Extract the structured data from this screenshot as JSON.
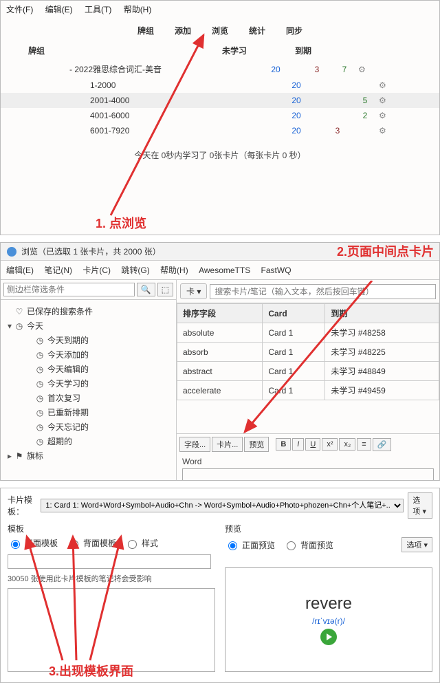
{
  "menu": {
    "file": "文件(F)",
    "edit": "编辑(E)",
    "tools": "工具(T)",
    "help": "帮助(H)"
  },
  "nav": {
    "decks": "牌组",
    "add": "添加",
    "browse": "浏览",
    "stats": "统计",
    "sync": "同步"
  },
  "deckheader": {
    "deck": "牌组",
    "new": "未学习",
    "due": "到期"
  },
  "decks": [
    {
      "name": "- 2022雅思综合词汇-美音",
      "new": "20",
      "lrn": "3",
      "due": "7",
      "root": true
    },
    {
      "name": "1-2000",
      "new": "20",
      "lrn": "",
      "due": ""
    },
    {
      "name": "2001-4000",
      "new": "20",
      "lrn": "",
      "due": "5",
      "alt": true
    },
    {
      "name": "4001-6000",
      "new": "20",
      "lrn": "",
      "due": "2"
    },
    {
      "name": "6001-7920",
      "new": "20",
      "lrn": "3",
      "due": ""
    }
  ],
  "studynote": "今天在 0秒内学习了 0张卡片（每张卡片 0 秒）",
  "annot1": "1. 点浏览",
  "annot2": "2.页面中间点卡片",
  "annot3": "3.出现模板界面",
  "browser": {
    "title": "浏览（已选取 1 张卡片，共 2000 张）",
    "menu": {
      "edit": "编辑(E)",
      "notes": "笔记(N)",
      "cards": "卡片(C)",
      "jump": "跳转(G)",
      "help": "帮助(H)",
      "tts": "AwesomeTTS",
      "fastwq": "FastWQ"
    },
    "filter_ph": "侧边栏筛选条件",
    "tree": {
      "saved": "已保存的搜索条件",
      "today": "今天",
      "today_items": [
        "今天到期的",
        "今天添加的",
        "今天编辑的",
        "今天学习的",
        "首次复习",
        "已重新排期",
        "今天忘记的",
        "超期的"
      ],
      "flags": "旗标"
    },
    "tag": "卡",
    "search_ph": "搜索卡片/笔记（输入文本，然后按回车键）",
    "cols": {
      "sort": "排序字段",
      "card": "Card",
      "due": "到期"
    },
    "rows": [
      {
        "w": "absolute",
        "c": "Card 1",
        "d": "未学习 #48258"
      },
      {
        "w": "absorb",
        "c": "Card 1",
        "d": "未学习 #48225"
      },
      {
        "w": "abstract",
        "c": "Card 1",
        "d": "未学习 #48849"
      },
      {
        "w": "accelerate",
        "c": "Card 1",
        "d": "未学习 #49459"
      }
    ],
    "btn_fields": "字段...",
    "btn_cards": "卡片...",
    "btn_preview": "预览",
    "field_word": "Word"
  },
  "tpl": {
    "label": "卡片模板：",
    "select": "1: Card 1: Word+Word+Symbol+Audio+Chn -> Word+Symbol+Audio+Photo+phozen+Chn+个人笔记+..",
    "options": "选项 ▾",
    "left_title": "模板",
    "front": "正面模板",
    "back": "背面模板",
    "style": "样式",
    "affect": "30050 张使用此卡片模板的笔记将会受影响",
    "right_title": "预览",
    "pfront": "正面预览",
    "pback": "背面预览",
    "word": "revere",
    "pron": "/rɪˈvɪə(r)/"
  }
}
